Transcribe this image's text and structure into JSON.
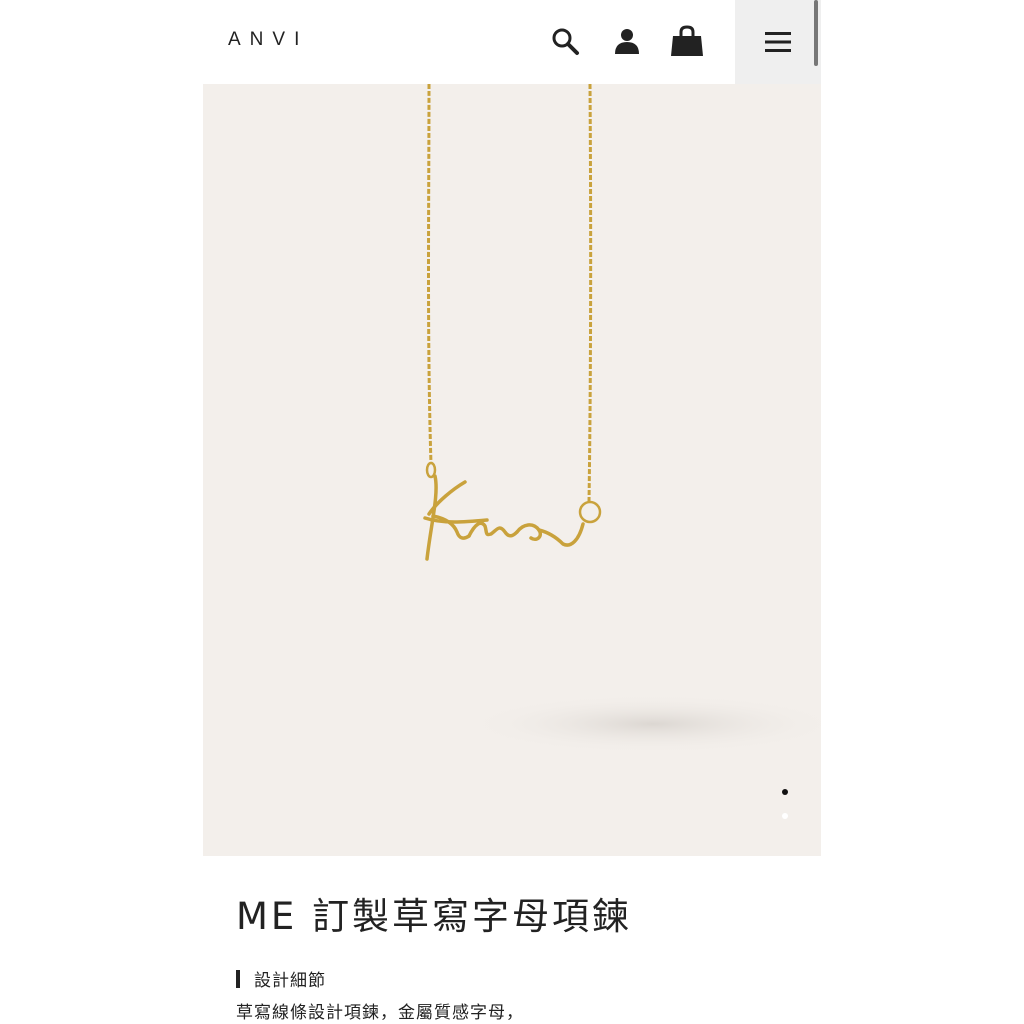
{
  "header": {
    "logo": "ANVI",
    "icons": [
      "search-icon",
      "user-icon",
      "shopping-bag-icon",
      "menu-icon"
    ]
  },
  "carousel": {
    "slide_count": 2,
    "active_index": 0,
    "image": "gold-script-name-necklace",
    "pendant_text": "Kira"
  },
  "product": {
    "title": "ME 訂製草寫字母項鍊",
    "section_heading": "設計細節",
    "section_text": "草寫線條設計項鍊，金屬質感字母，"
  },
  "colors": {
    "hero_bg": "#f3efeb",
    "gold": "#c9a23c",
    "text": "#222222",
    "menu_bg": "#efefef"
  }
}
